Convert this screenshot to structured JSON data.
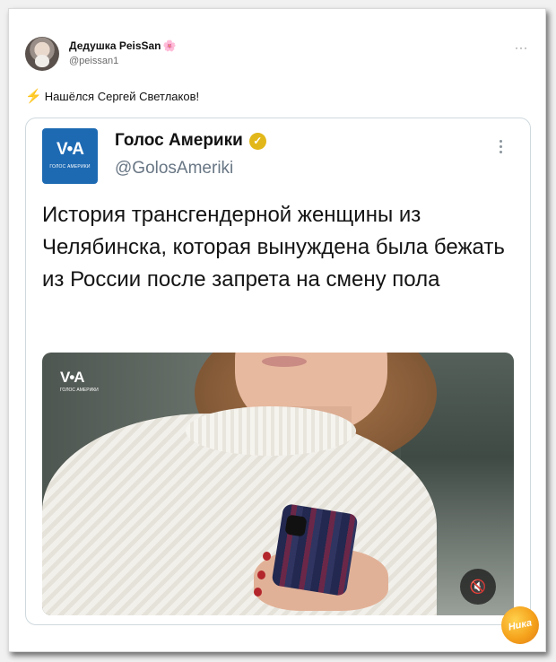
{
  "post": {
    "author_name": "Дедушка PeisSan",
    "author_emoji": "🌸",
    "author_handle": "@peissan1",
    "more_label": "···",
    "bolt_icon": "⚡",
    "text": "Нашёлся Сергей Светлаков!"
  },
  "quote": {
    "logo_mark": "V•A",
    "logo_sub": "ГОЛОС АМЕРИКИ",
    "account_name": "Голос Америки",
    "verified_icon": "✓",
    "verified_color": "#e2b719",
    "account_handle": "@GolosAmeriki",
    "text": "История трансгендерной женщины из Челябинска, которая вынуждена была бежать из России после запрета на смену пола",
    "video": {
      "logo_mark": "V•A",
      "logo_sub": "ГОЛОС АМЕРИКИ",
      "mute_icon": "🔇"
    }
  },
  "watermark": {
    "text": "Ника"
  },
  "colors": {
    "accent_blue": "#1d6ab3",
    "handle_gray": "#687684",
    "watermark_orange": "#f5a21c"
  }
}
